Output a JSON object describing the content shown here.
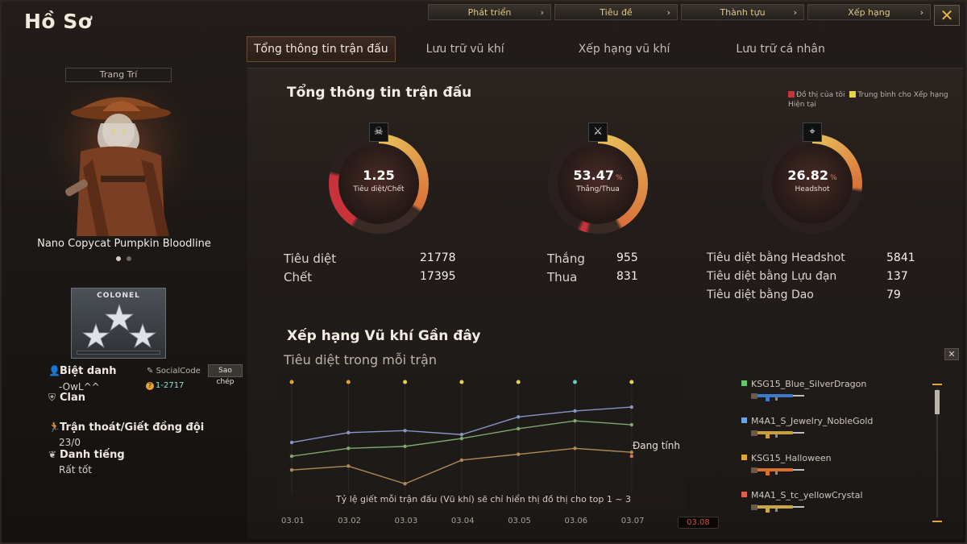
{
  "app": {
    "title": "Hồ Sơ"
  },
  "topnav": [
    {
      "label": "Phát triển"
    },
    {
      "label": "Tiêu đề"
    },
    {
      "label": "Thành tựu"
    },
    {
      "label": "Xếp hạng"
    }
  ],
  "tabs": [
    {
      "label": "Tổng thông tin trận đấu",
      "active": true
    },
    {
      "label": "Lưu trữ vũ khí"
    },
    {
      "label": "Xếp hạng vũ khí"
    },
    {
      "label": "Lưu trữ cá nhân"
    }
  ],
  "character": {
    "section_label": "Trang Trí",
    "name": "Nano Copycat Pumpkin Bloodline",
    "rank_title": "COLONEL"
  },
  "profile": {
    "nickname_label": "Biệt danh",
    "nickname": "-OwL^^",
    "social_label": "SocialCode",
    "copy_label": "Sao chép",
    "social_code": "1-2717",
    "clan_label": "Clan",
    "desert_label": "Trận thoát/Giết đồng đội",
    "desert_value": "23/0",
    "reputation_label": "Danh tiếng",
    "reputation_value": "Rất tốt"
  },
  "summary": {
    "title": "Tổng thông tin trận đấu",
    "legend_mine": "Đồ thị của tôi",
    "legend_avg": "Trung bình cho Xếp hạng Hiện tại",
    "gauges": [
      {
        "value": "1.25",
        "unit": "",
        "label": "Tiêu diệt/Chết",
        "icon": "skull-icon"
      },
      {
        "value": "53.47",
        "unit": "%",
        "label": "Thắng/Thua",
        "icon": "crossed-swords-icon"
      },
      {
        "value": "26.82",
        "unit": "%",
        "label": "Headshot",
        "icon": "crosshair-icon"
      }
    ],
    "kills_label": "Tiêu diệt",
    "kills": "21778",
    "deaths_label": "Chết",
    "deaths": "17395",
    "wins_label": "Thắng",
    "wins": "955",
    "losses_label": "Thua",
    "losses": "831",
    "hs_kills_label": "Tiêu diệt bằng Headshot",
    "hs_kills": "5841",
    "grenade_kills_label": "Tiêu diệt bằng Lựu đạn",
    "grenade_kills": "137",
    "knife_kills_label": "Tiêu diệt bằng Dao",
    "knife_kills": "79"
  },
  "recent": {
    "title": "Xếp hạng Vũ khí Gần đây",
    "subtitle": "Tiêu diệt trong mỗi trận",
    "calculating": "Đang tính",
    "note": "Tỷ lệ giết mỗi trận đấu (Vũ khí) sẽ chỉ hiển thị đồ thị cho top 1 ~ 3",
    "dates": [
      "03.01",
      "03.02",
      "03.03",
      "03.04",
      "03.05",
      "03.06",
      "03.07",
      "03.08"
    ],
    "current_date": "03.08"
  },
  "chart_data": {
    "type": "line",
    "title": "Tiêu diệt trong mỗi trận",
    "x": [
      "03.01",
      "03.02",
      "03.03",
      "03.04",
      "03.05",
      "03.06",
      "03.07"
    ],
    "series": [
      {
        "name": "KSG15_Blue_SilverDragon",
        "color": "#8795c7",
        "values": [
          1.5,
          2.0,
          2.1,
          1.9,
          2.8,
          3.1,
          3.3
        ]
      },
      {
        "name": "M4A1_S_Jewelry_NobleGold",
        "color": "#7fa86b",
        "values": [
          0.8,
          1.2,
          1.3,
          1.7,
          2.2,
          2.6,
          2.4
        ]
      },
      {
        "name": "KSG15_Halloween",
        "color": "#b08a55",
        "values": [
          0.1,
          0.3,
          -0.6,
          0.6,
          0.9,
          1.2,
          1.0
        ]
      },
      {
        "name": "M4A1_S_tc_yellowCrystal",
        "color": "#d9735a",
        "values": [
          null,
          null,
          null,
          null,
          null,
          null,
          0.8
        ]
      }
    ],
    "marker_colors": [
      "#e3a435",
      "#e3a435",
      "#e8d24a",
      "#e8d24a",
      "#e8d24a",
      "#5fd0c0",
      "#e8d24a"
    ],
    "grid": true
  },
  "weapons": [
    {
      "name": "KSG15_Blue_SilverDragon",
      "color": "#5fc86a",
      "gun_color": "#3d79c8"
    },
    {
      "name": "M4A1_S_Jewelry_NobleGold",
      "color": "#6aa3e6",
      "gun_color": "#c8a03a"
    },
    {
      "name": "KSG15_Halloween",
      "color": "#e3a435",
      "gun_color": "#d9702a"
    },
    {
      "name": "M4A1_S_tc_yellowCrystal",
      "color": "#e06050",
      "gun_color": "#c9a84a"
    }
  ]
}
